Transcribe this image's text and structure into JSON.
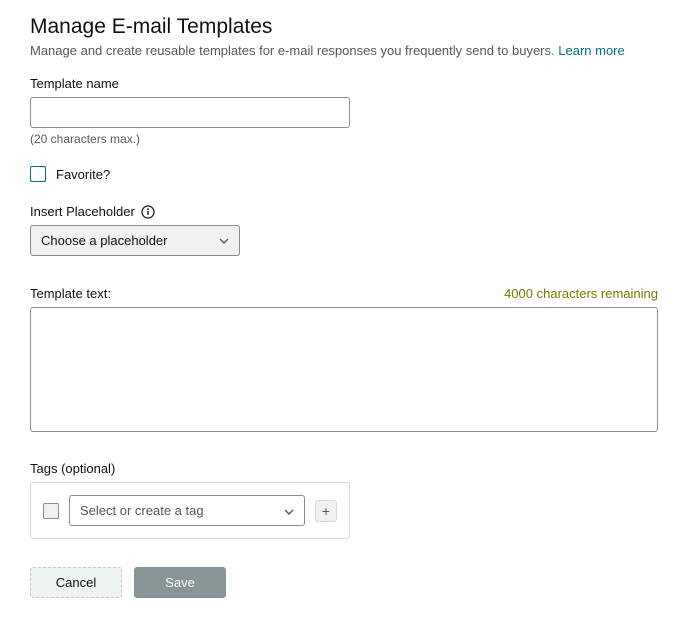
{
  "page": {
    "title": "Manage E-mail Templates",
    "subtitle": "Manage and create reusable templates for e-mail responses you frequently send to buyers.",
    "learn_more": "Learn more"
  },
  "template_name": {
    "label": "Template name",
    "value": "",
    "helper": "(20 characters max.)"
  },
  "favorite": {
    "label": "Favorite?"
  },
  "placeholder": {
    "label": "Insert Placeholder",
    "selected": "Choose a placeholder"
  },
  "template_text": {
    "label": "Template text:",
    "remaining": "4000 characters remaining",
    "value": ""
  },
  "tags": {
    "label": "Tags (optional)",
    "placeholder": "Select or create a tag",
    "add_label": "+"
  },
  "buttons": {
    "cancel": "Cancel",
    "save": "Save"
  }
}
